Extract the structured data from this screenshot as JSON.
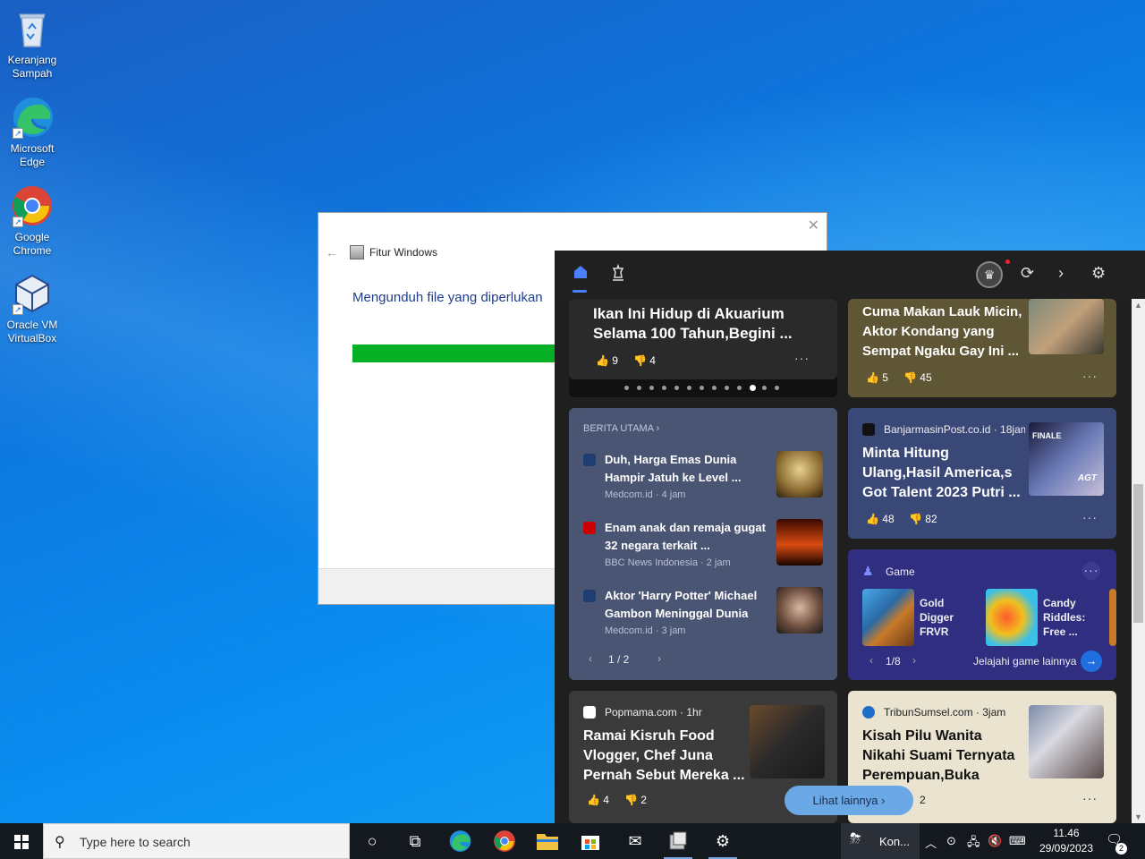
{
  "desktop": {
    "icons": [
      {
        "label": "Keranjang Sampah",
        "icon": "recycle-bin-icon"
      },
      {
        "label": "Microsoft Edge",
        "icon": "edge-icon"
      },
      {
        "label": "Google Chrome",
        "icon": "chrome-icon"
      },
      {
        "label": "Oracle VM VirtualBox",
        "icon": "virtualbox-icon"
      }
    ]
  },
  "dialog": {
    "title": "Fitur Windows",
    "message": "Mengunduh file yang diperlukan",
    "progress": 0.52,
    "progress_color": "#06b025"
  },
  "news_panel": {
    "carousel_card": {
      "headline": "Ikan Ini Hidup di Akuarium Selama 100 Tahun,Begini ...",
      "likes": "9",
      "dislikes": "4",
      "dots_total": 13,
      "dots_active": 11
    },
    "card_top_right": {
      "headline": "Cuma Makan Lauk Micin, Aktor Kondang yang Sempat Ngaku Gay Ini ...",
      "likes": "5",
      "dislikes": "45"
    },
    "top_stories": {
      "section_label": "BERITA UTAMA",
      "items": [
        {
          "title": "Duh, Harga Emas Dunia Hampir Jatuh ke Level ...",
          "meta": "Medcom.id · 4 jam"
        },
        {
          "title": "Enam anak dan remaja gugat 32 negara terkait ...",
          "meta": "BBC News Indonesia · 2 jam"
        },
        {
          "title": "Aktor 'Harry Potter' Michael Gambon Meninggal Dunia",
          "meta": "Medcom.id · 3 jam"
        }
      ],
      "pager": "1 / 2"
    },
    "card_agt": {
      "source": "BanjarmasinPost.co.id · 18jam",
      "headline": "Minta Hitung Ulang,Hasil America,s Got Talent 2023 Putri ...",
      "likes": "48",
      "dislikes": "82",
      "thumb_caption": "FINALE",
      "thumb_logo": "AGT"
    },
    "games": {
      "title": "Game",
      "items": [
        {
          "name": "Gold Digger FRVR"
        },
        {
          "name": "Candy Riddles: Free ..."
        }
      ],
      "pager": "1/8",
      "explore": "Jelajahi game lainnya"
    },
    "card_popmama": {
      "source": "Popmama.com · 1hr",
      "headline": "Ramai Kisruh Food Vlogger, Chef Juna Pernah Sebut Mereka ...",
      "likes": "4",
      "dislikes": "2"
    },
    "card_tribun": {
      "source": "TribunSumsel.com · 3jam",
      "headline": "Kisah Pilu Wanita Nikahi Suami Ternyata Perempuan,Buka Suara...",
      "count": "2"
    },
    "see_more": "Lihat lainnya",
    "accent": "#4a7fff"
  },
  "taskbar": {
    "search_placeholder": "Type here to search",
    "weather_label": "Kon...",
    "time": "11.46",
    "date": "29/09/2023",
    "notifications": "2"
  }
}
